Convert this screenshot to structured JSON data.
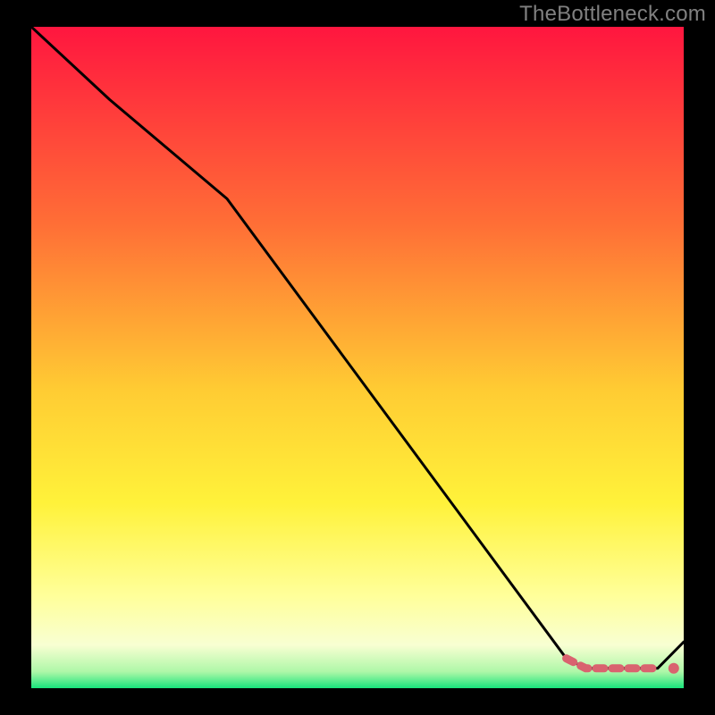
{
  "watermark": "TheBottleneck.com",
  "colors": {
    "page_bg": "#000000",
    "watermark": "#808080",
    "line": "#000000",
    "marker_fill": "#D9636F",
    "marker_stroke": "#C24A56",
    "gradient_top": "#FF163F",
    "gradient_mid_upper": "#FF8C33",
    "gradient_mid": "#FFE33A",
    "gradient_lower": "#FFFF84",
    "gradient_pale": "#F4FFC9",
    "gradient_bottom": "#18E47B"
  },
  "chart_data": {
    "type": "line",
    "title": "",
    "xlabel": "",
    "ylabel": "",
    "xlim": [
      0,
      100
    ],
    "ylim": [
      0,
      100
    ],
    "series": [
      {
        "name": "curve",
        "x": [
          0,
          12,
          30,
          82,
          85,
          92,
          96,
          100
        ],
        "y": [
          100,
          89,
          74,
          4.5,
          3.0,
          3.0,
          3.0,
          7
        ],
        "markers_range": [
          3,
          6
        ]
      }
    ],
    "background_gradient_stops": [
      {
        "offset": 0.0,
        "color": "#FF163F"
      },
      {
        "offset": 0.3,
        "color": "#FF6F36"
      },
      {
        "offset": 0.55,
        "color": "#FFCC33"
      },
      {
        "offset": 0.72,
        "color": "#FFF23A"
      },
      {
        "offset": 0.86,
        "color": "#FFFF9A"
      },
      {
        "offset": 0.935,
        "color": "#F8FFD2"
      },
      {
        "offset": 0.975,
        "color": "#AEF7A8"
      },
      {
        "offset": 1.0,
        "color": "#18E47B"
      }
    ]
  }
}
